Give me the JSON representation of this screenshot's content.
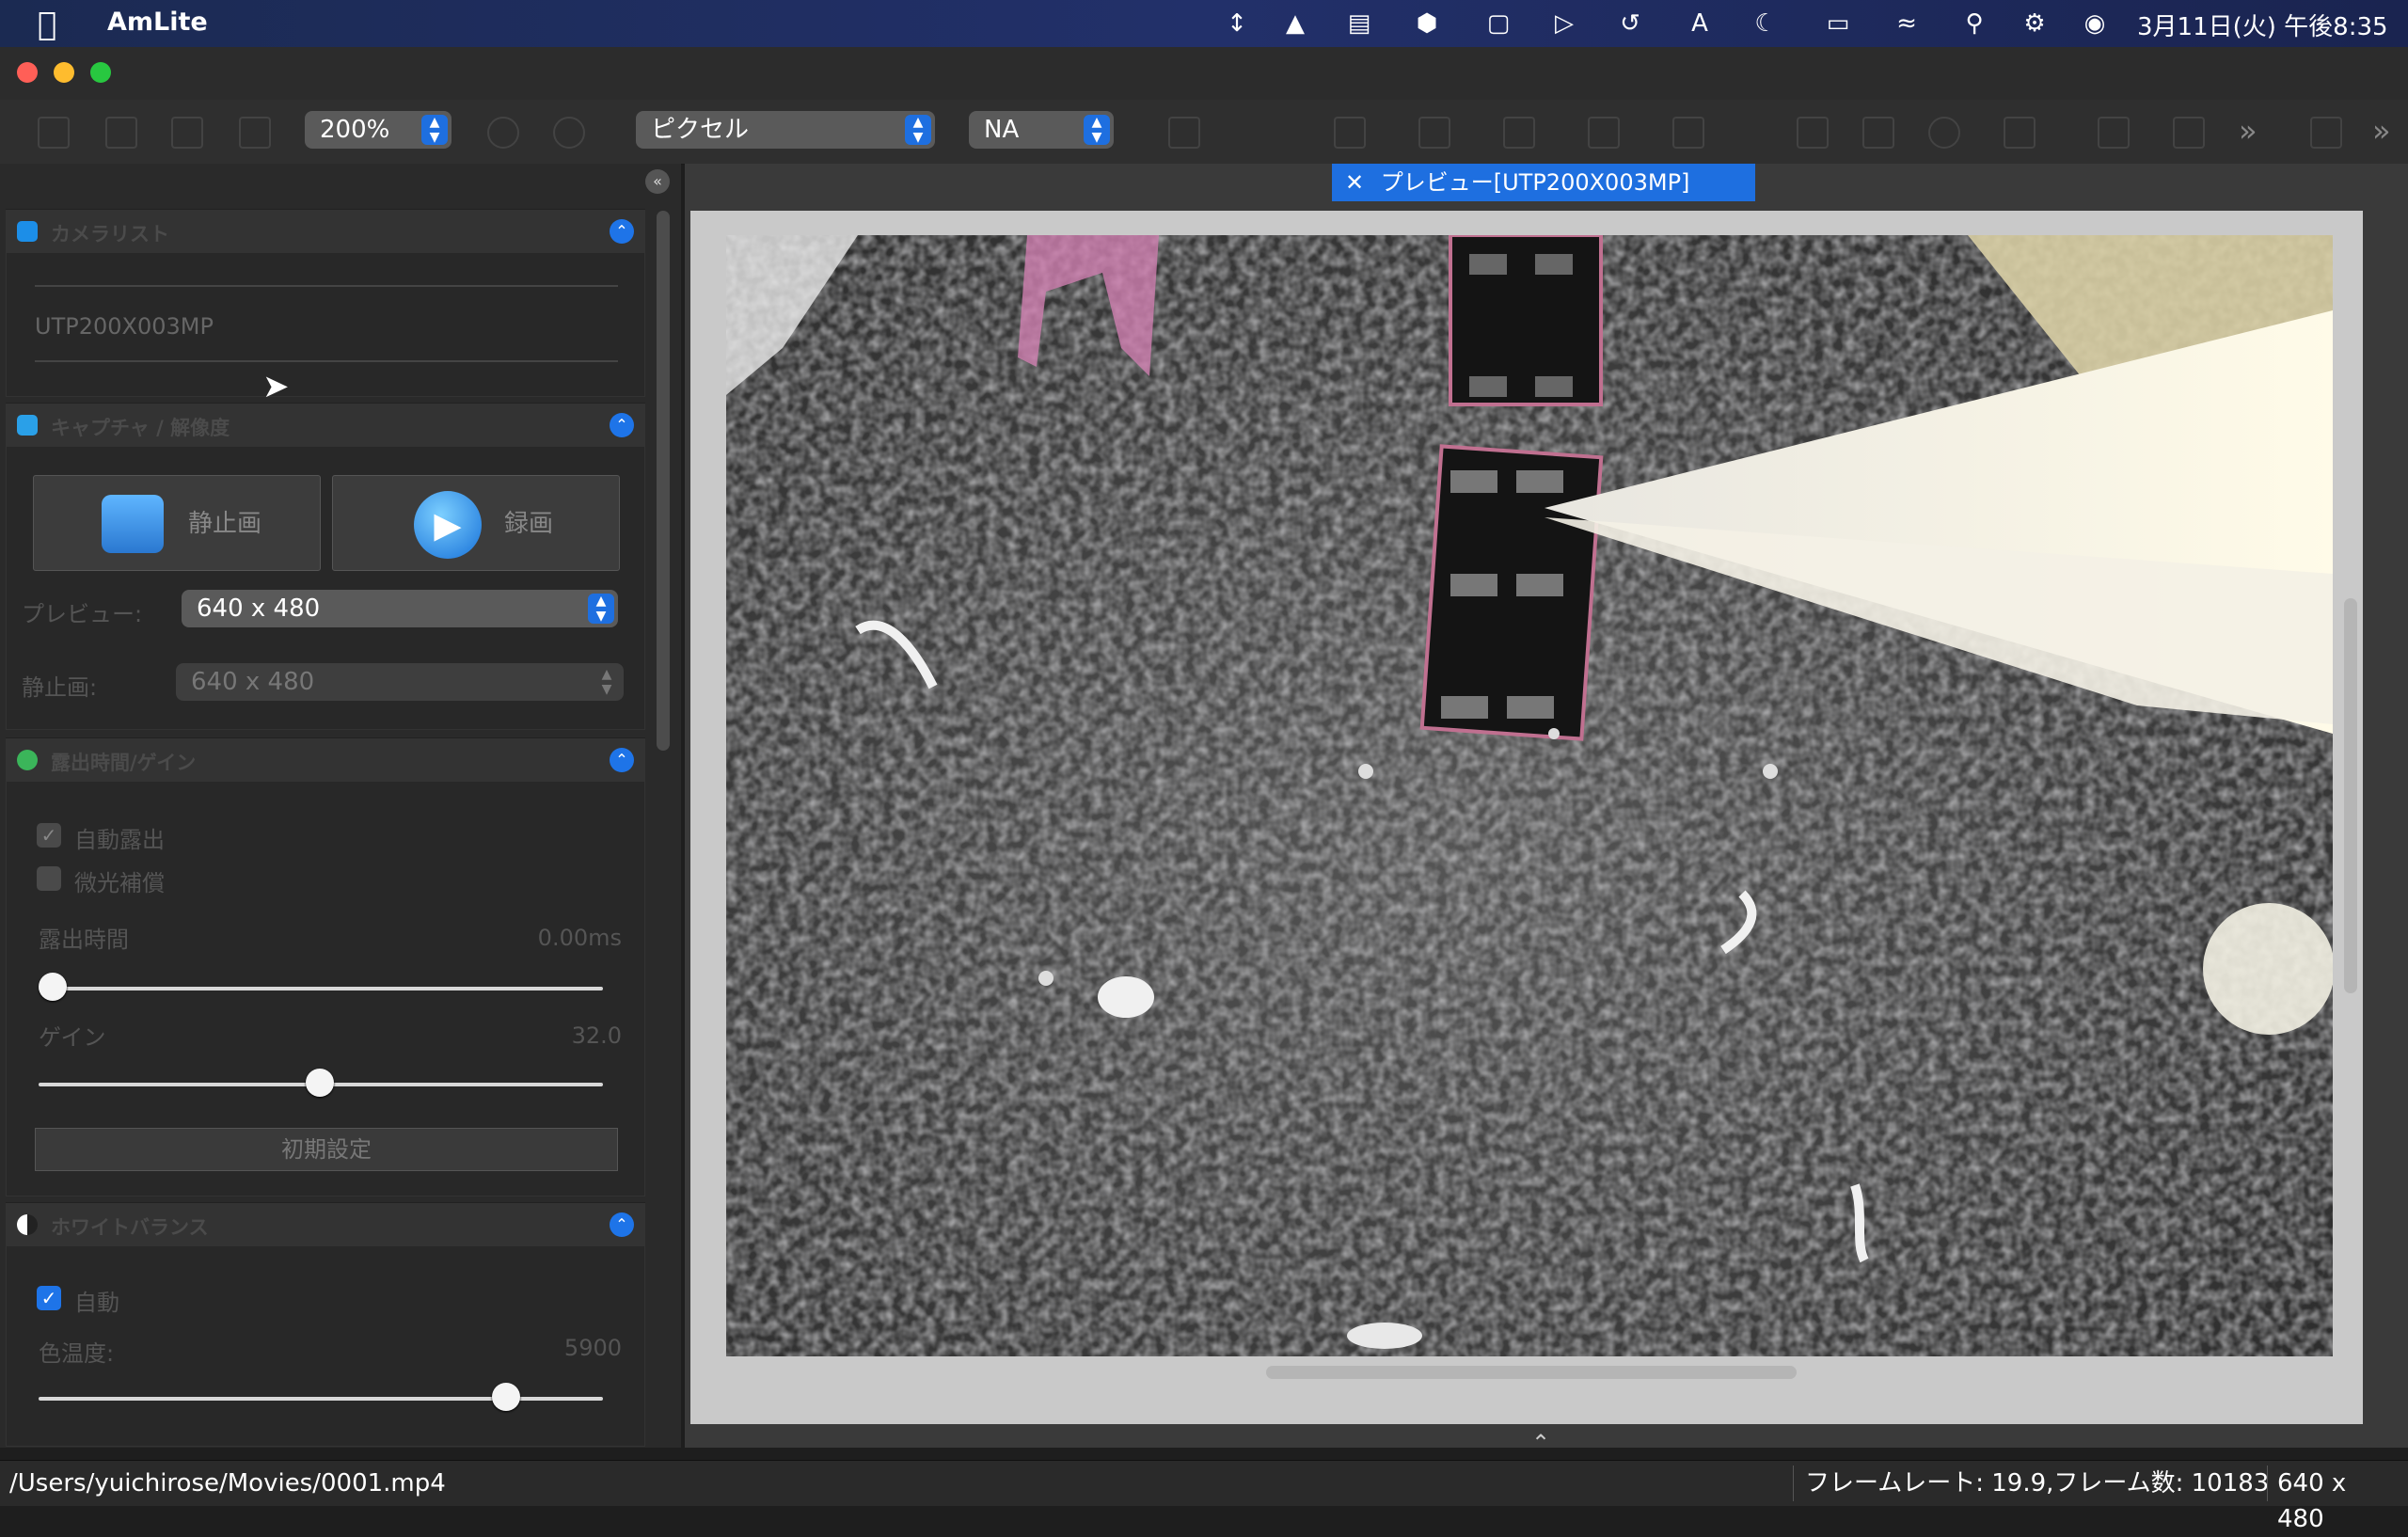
{
  "menubar": {
    "app_name": "AmLite",
    "clock": "3月11日(火) 午後8:35",
    "icons": [
      "arrows-vertical-icon",
      "drive-icon",
      "clipboard-icon",
      "cube-icon",
      "square-icon",
      "play-circle-icon",
      "history-icon",
      "text-input-icon",
      "moon-icon",
      "battery-icon",
      "wifi-icon",
      "search-icon",
      "control-center-icon",
      "siri-icon"
    ]
  },
  "toolbar": {
    "zoom": "200%",
    "unit": "ピクセル",
    "calibration": "NA",
    "more": "»"
  },
  "tab": {
    "close": "✕",
    "title": "プレビュー[UTP200X003MP]"
  },
  "panels": {
    "camera_list": {
      "title": "カメラリスト",
      "camera": "UTP200X003MP"
    },
    "capture": {
      "title": "キャプチャ / 解像度",
      "still_label": "静止画",
      "record_label": "録画",
      "preview_label": "プレビュー:",
      "preview_value": "640 x 480",
      "still_res_label": "静止画:",
      "still_res_value": "640 x 480"
    },
    "exposure": {
      "title": "露出時間/ゲイン",
      "auto_exposure": "自動露出",
      "auto_exposure_checked": true,
      "low_light": "微光補償",
      "low_light_checked": false,
      "exposure_label": "露出時間",
      "exposure_value": "0.00ms",
      "exposure_level": 0.0,
      "gain_label": "ゲイン",
      "gain_value": "32.0",
      "gain_level": 0.5,
      "reset_label": "初期設定"
    },
    "white_balance": {
      "title": "ホワイトバランス",
      "auto_label": "自動",
      "auto_checked": true,
      "temp_label": "色温度:",
      "temp_value": "5900",
      "temp_level": 0.82
    }
  },
  "status": {
    "path": "/Users/yuichirose/Movies/0001.mp4",
    "fps": "フレームレート: 19.9,フレーム数: 10183",
    "resolution": "640 x 480"
  },
  "colors": {
    "accent": "#1e6fe0",
    "menubar": "#1f2c5c",
    "panel": "#2a2a2a"
  }
}
